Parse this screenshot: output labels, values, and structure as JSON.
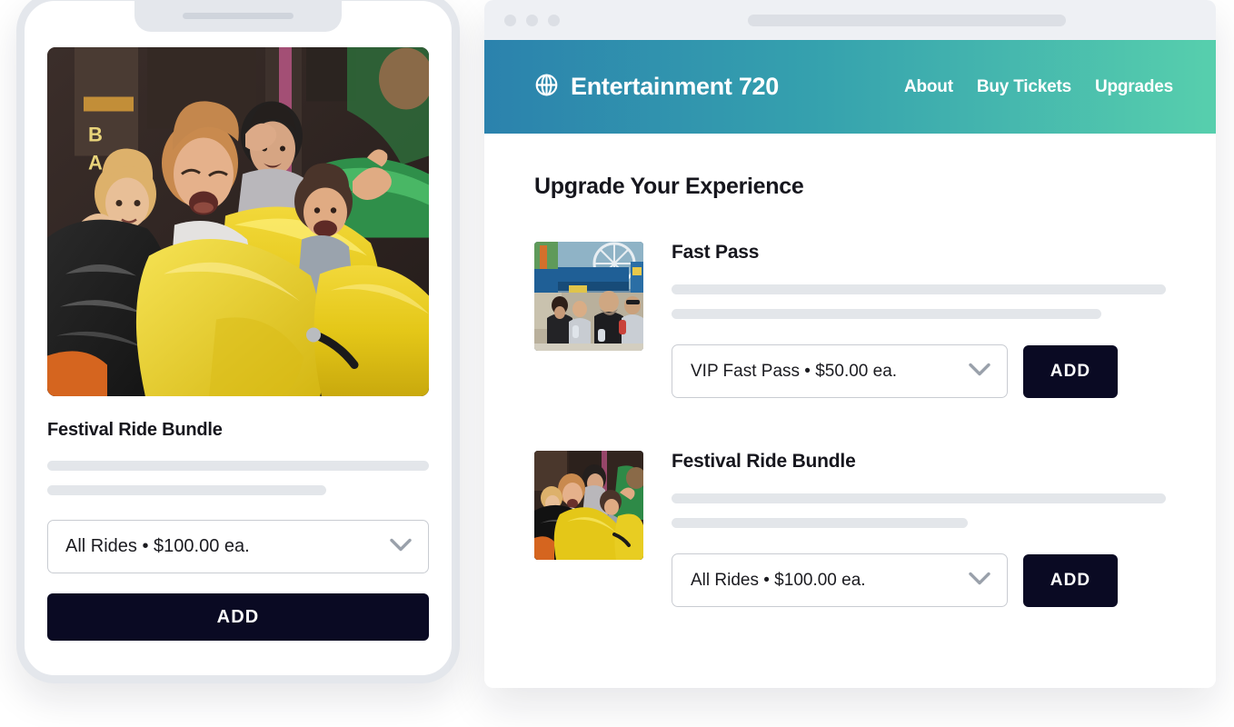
{
  "theme": {
    "header_gradient_from": "#2b82ad",
    "header_gradient_to": "#57cfad",
    "button_bg": "#0a0a23",
    "button_text": "#ffffff",
    "skeleton": "#e3e6ea",
    "text_dark": "#16161d"
  },
  "phone": {
    "hero_image_alt": "family-on-roller-coaster-photo",
    "product_title": "Festival Ride Bundle",
    "select": {
      "value": "All Rides  •  $100.00 ea.",
      "options": [
        "All Rides  •  $100.00 ea."
      ]
    },
    "add_label": "ADD"
  },
  "browser": {
    "chrome": {
      "dots": [
        "red-dot",
        "yellow-dot",
        "green-dot"
      ],
      "urlbar_value": ""
    },
    "site_header": {
      "logo_icon": "globe-icon",
      "brand": "Entertainment 720",
      "nav": [
        {
          "label": "About"
        },
        {
          "label": "Buy Tickets"
        },
        {
          "label": "Upgrades"
        }
      ]
    },
    "page_title": "Upgrade Your Experience",
    "products": [
      {
        "thumb_alt": "amusement-park-crowd-photo",
        "title": "Fast Pass",
        "select": {
          "value": "VIP Fast Pass • $50.00 ea.",
          "options": [
            "VIP Fast Pass • $50.00 ea."
          ]
        },
        "add_label": "ADD"
      },
      {
        "thumb_alt": "family-on-roller-coaster-photo",
        "title": "Festival Ride Bundle",
        "select": {
          "value": "All Rides  •  $100.00 ea.",
          "options": [
            "All Rides  •  $100.00 ea."
          ]
        },
        "add_label": "ADD"
      }
    ]
  }
}
